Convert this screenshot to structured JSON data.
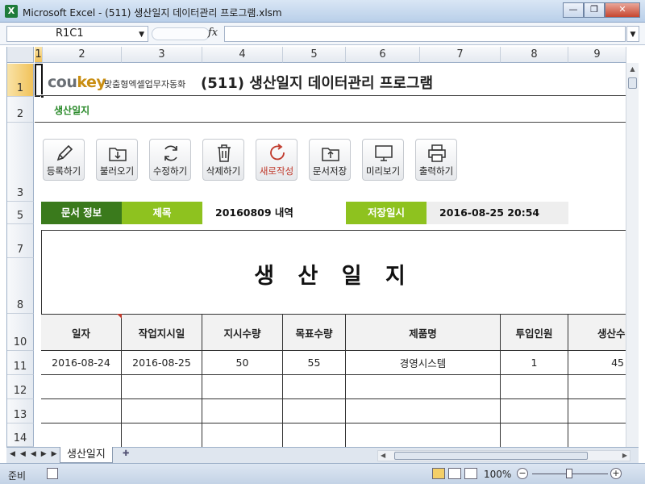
{
  "window": {
    "title": "Microsoft Excel - (511) 생산일지 데이터관리 프로그램.xlsm",
    "app_icon": "X"
  },
  "formula_bar": {
    "name_box": "R1C1",
    "fx": "fx"
  },
  "columns": [
    "1",
    "2",
    "3",
    "4",
    "5",
    "6",
    "7",
    "8",
    "9"
  ],
  "rows": [
    "1",
    "2",
    "3",
    "5",
    "7",
    "8",
    "10",
    "11",
    "12",
    "13",
    "14"
  ],
  "header": {
    "logo_main": "cou",
    "logo_key": "key",
    "logo_sub": "맞춤형엑셀업무자동화",
    "title": "(511) 생산일지 데이터관리 프로그램",
    "subtitle": "생산일지"
  },
  "toolbar": [
    {
      "label": "등록하기",
      "icon": "pencil-icon"
    },
    {
      "label": "불러오기",
      "icon": "folder-download-icon"
    },
    {
      "label": "수정하기",
      "icon": "refresh-icon"
    },
    {
      "label": "삭제하기",
      "icon": "trash-icon"
    },
    {
      "label": "새로작성",
      "icon": "new-icon"
    },
    {
      "label": "문서저장",
      "icon": "folder-upload-icon"
    },
    {
      "label": "미리보기",
      "icon": "monitor-icon"
    },
    {
      "label": "출력하기",
      "icon": "printer-icon"
    }
  ],
  "doc_info": {
    "section_label": "문서 정보",
    "title_label": "제목",
    "title_value": "20160809 내역",
    "saved_label": "저장일시",
    "saved_value": "2016-08-25 20:54"
  },
  "sheet_title": "생 산 일 지",
  "table": {
    "headers": [
      "일자",
      "작업지시일",
      "지시수량",
      "목표수량",
      "제품명",
      "투입인원",
      "생산수"
    ],
    "rows": [
      [
        "2016-08-24",
        "2016-08-25",
        "50",
        "55",
        "경영시스템",
        "1",
        "45"
      ]
    ]
  },
  "sheet_tab": "생산일지",
  "status": {
    "ready": "준비",
    "zoom": "100%"
  },
  "colors": {
    "info_dark": "#3a7a1c",
    "info_light": "#8ec21f",
    "subtitle": "#2a8a2a",
    "accent_red": "#c0392b"
  }
}
